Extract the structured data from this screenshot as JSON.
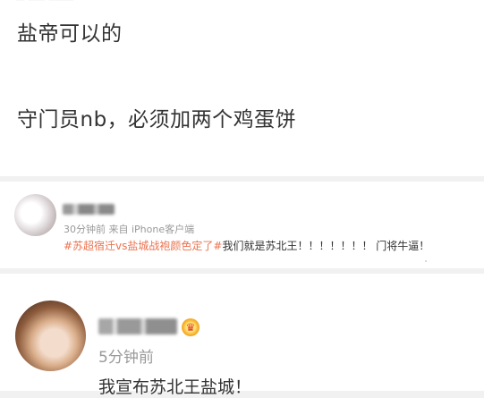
{
  "post": {
    "lines": [
      "盐帝可以的",
      "守门员nb，必须加两个鸡蛋饼"
    ]
  },
  "comments": [
    {
      "time": "30分钟前",
      "source": "来自 iPhone客户端",
      "topic": "#苏超宿迁vs盐城战袍颜色定了#",
      "text": "我们就是苏北王！！！！！！！ 门将牛逼！"
    },
    {
      "time": "5分钟前",
      "badge_icon": "crown-badge-icon",
      "text": "我宣布苏北王盐城！"
    }
  ],
  "colors": {
    "topic_link": "#eb7350",
    "meta_text": "#999999",
    "separator": "#f1f1f1"
  }
}
